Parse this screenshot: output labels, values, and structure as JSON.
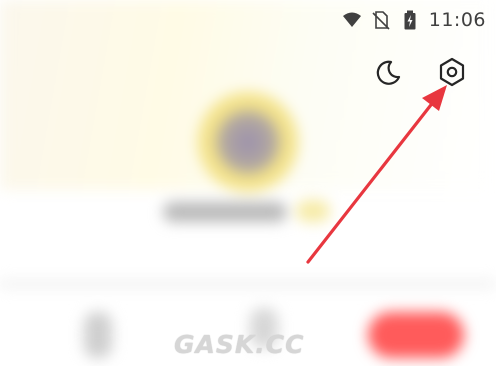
{
  "status_bar": {
    "time": "11:06",
    "icons": [
      "wifi-icon",
      "no-sim-icon",
      "battery-charging-icon"
    ]
  },
  "toolbar": {
    "night_mode_icon": "moon-icon",
    "settings_icon": "gear-icon"
  },
  "annotation": {
    "color": "#e8373f",
    "target": "settings-button"
  },
  "watermark": {
    "text": "GASK.CC"
  },
  "colors": {
    "accent_red": "#ff5b5b",
    "avatar_yellow": "#f4e38a"
  }
}
